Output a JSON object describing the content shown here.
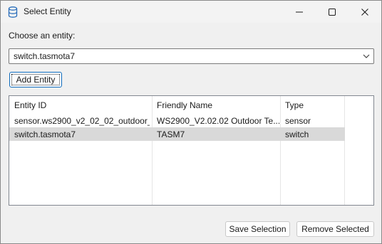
{
  "window": {
    "title": "Select Entity",
    "icon": "database-icon",
    "controls": [
      "minimize-icon",
      "maximize-icon",
      "close-icon"
    ]
  },
  "form": {
    "choose_label": "Choose an entity:",
    "combo_value": "switch.tasmota7",
    "add_button": "Add Entity"
  },
  "table": {
    "headers": [
      "Entity ID",
      "Friendly Name",
      "Type"
    ],
    "rows": [
      {
        "entity_id": "sensor.ws2900_v2_02_02_outdoor_...",
        "friendly_name": "WS2900_V2.02.02 Outdoor Te...",
        "type": "sensor",
        "selected": false
      },
      {
        "entity_id": "switch.tasmota7",
        "friendly_name": "TASM7",
        "type": "switch",
        "selected": true
      }
    ]
  },
  "footer": {
    "save_button": "Save Selection",
    "remove_button": "Remove Selected"
  },
  "colors": {
    "selected_row": "#d9d9d9",
    "focus_border": "#0f6cbd",
    "window_bg": "#f0f0f0"
  }
}
